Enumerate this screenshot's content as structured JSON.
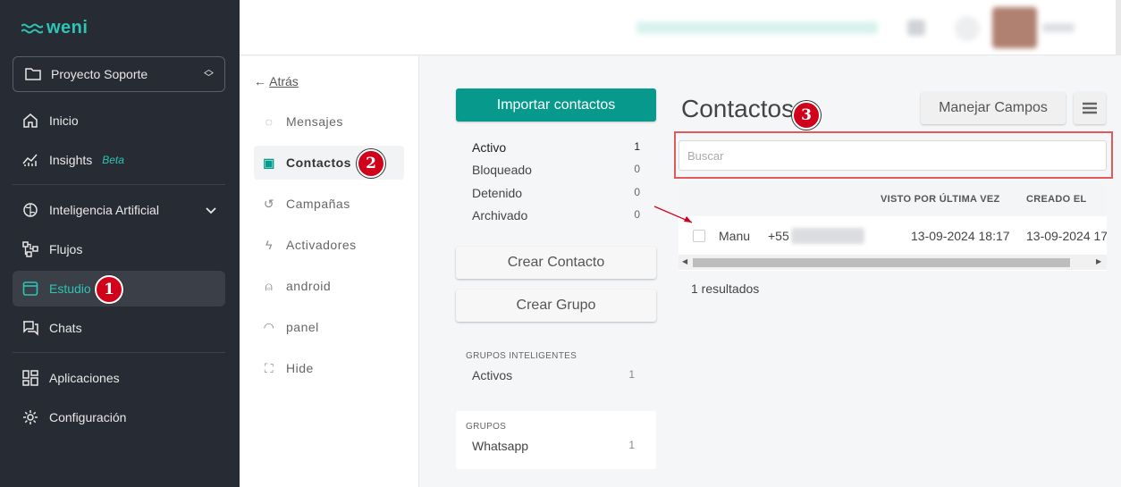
{
  "brand": {
    "name": "weni",
    "accent": "#2ec4b6"
  },
  "project": {
    "name": "Proyecto Soporte"
  },
  "sidebar": {
    "items": [
      {
        "label": "Inicio",
        "icon": "home-icon"
      },
      {
        "label": "Insights",
        "beta": "Beta",
        "icon": "chart-icon"
      },
      {
        "label": "Inteligencia Artificial",
        "icon": "brain-icon"
      },
      {
        "label": "Flujos",
        "icon": "flows-icon"
      },
      {
        "label": "Estudio",
        "icon": "studio-icon",
        "active": true
      },
      {
        "label": "Chats",
        "icon": "chats-icon"
      },
      {
        "label": "Aplicaciones",
        "icon": "apps-icon"
      },
      {
        "label": "Configuración",
        "icon": "gear-icon"
      }
    ]
  },
  "annotations": {
    "one": "1",
    "two": "2",
    "three": "3"
  },
  "subnav": {
    "back_arrow": "←",
    "back": "Atrás",
    "items": [
      {
        "label": "Mensajes",
        "icon": "message-icon"
      },
      {
        "label": "Contactos",
        "icon": "contacts-icon",
        "active": true
      },
      {
        "label": "Campañas",
        "icon": "history-icon"
      },
      {
        "label": "Activadores",
        "icon": "bolt-icon"
      },
      {
        "label": "android",
        "icon": "android-icon"
      },
      {
        "label": "panel",
        "icon": "gauge-icon"
      },
      {
        "label": "Hide",
        "icon": "hide-icon"
      }
    ]
  },
  "contacts": {
    "import_label": "Importar contactos",
    "statuses": [
      {
        "label": "Activo",
        "count": "1"
      },
      {
        "label": "Bloqueado",
        "count": "0"
      },
      {
        "label": "Detenido",
        "count": "0"
      },
      {
        "label": "Archivado",
        "count": "0"
      }
    ],
    "create_contact": "Crear Contacto",
    "create_group": "Crear Grupo",
    "smart_groups": {
      "title": "GRUPOS INTELIGENTES",
      "items": [
        {
          "label": "Activos",
          "count": "1"
        }
      ]
    },
    "groups": {
      "title": "GRUPOS",
      "items": [
        {
          "label": "Whatsapp",
          "count": "1"
        }
      ]
    },
    "title": "Contactos",
    "manage_fields": "Manejar Campos",
    "search_placeholder": "Buscar",
    "table": {
      "headers": [
        "VISTO POR ÚLTIMA VEZ",
        "CREADO EL"
      ],
      "rows": [
        {
          "name": "Manu",
          "phone": "+55",
          "last_seen": "13-09-2024 18:17",
          "created": "13-09-2024 17"
        }
      ]
    },
    "results": "1 resultados"
  }
}
